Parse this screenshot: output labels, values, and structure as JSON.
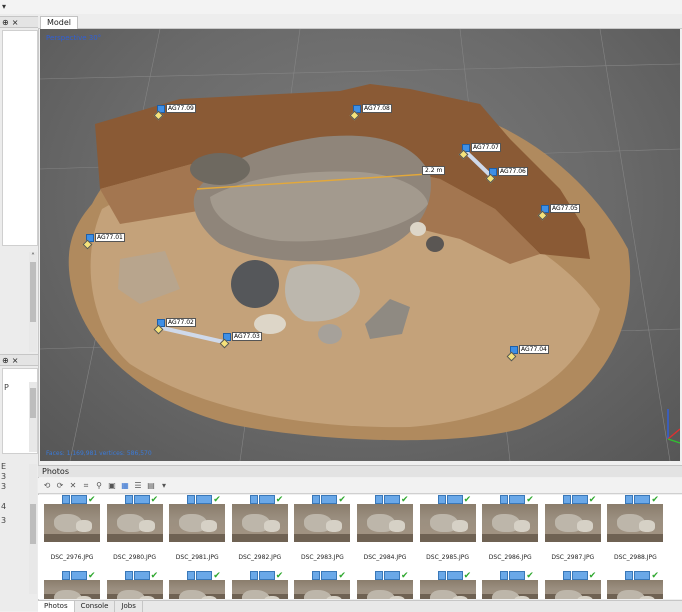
{
  "menu": {
    "dropdown_glyph": "▾",
    "close_glyph": "×"
  },
  "left_panel": {
    "bar1_label": "×",
    "bar2_label": "×",
    "bar3_label": "×",
    "chars_a": [
      "E",
      "3",
      "3"
    ],
    "chars_b": [
      "4",
      "3"
    ],
    "p_label": "P"
  },
  "tabs": {
    "model": "Model"
  },
  "viewport": {
    "perspective": "Perspective 30°",
    "stats": "Faces: 1,169,981 vertices: 586,570",
    "scale_label": "2.2 m",
    "markers": [
      {
        "label": "AG77.09"
      },
      {
        "label": "AG77.08"
      },
      {
        "label": "AG77.07"
      },
      {
        "label": "AG77.06"
      },
      {
        "label": "AG77.05"
      },
      {
        "label": "AG77.01"
      },
      {
        "label": "AG77.02"
      },
      {
        "label": "AG77.03"
      },
      {
        "label": "AG77.04"
      }
    ],
    "axis_colors": {
      "x": "#e03030",
      "y": "#30c030",
      "z": "#3060e0"
    }
  },
  "photos": {
    "title": "Photos",
    "toolbar_icons": [
      "rotate-left-icon",
      "rotate-right-icon",
      "delete-icon",
      "crop-icon",
      "filter-icon",
      "image-icon",
      "thumbnails-icon",
      "list-icon",
      "details-icon",
      "dropdown-icon"
    ],
    "row1": [
      "DSC_2976.JPG",
      "DSC_2980.JPG",
      "DSC_2981.JPG",
      "DSC_2982.JPG",
      "DSC_2983.JPG",
      "DSC_2984.JPG",
      "DSC_2985.JPG",
      "DSC_2986.JPG",
      "DSC_2987.JPG",
      "DSC_2988.JPG"
    ]
  },
  "bottom_tabs": [
    "Photos",
    "Console",
    "Jobs"
  ]
}
